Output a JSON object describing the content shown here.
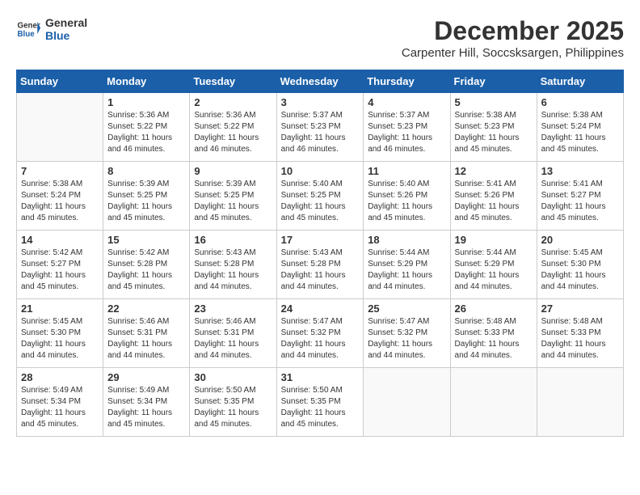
{
  "logo": {
    "line1": "General",
    "line2": "Blue"
  },
  "title": {
    "month": "December 2025",
    "location": "Carpenter Hill, Soccsksargen, Philippines"
  },
  "weekdays": [
    "Sunday",
    "Monday",
    "Tuesday",
    "Wednesday",
    "Thursday",
    "Friday",
    "Saturday"
  ],
  "weeks": [
    [
      {
        "day": "",
        "sunrise": "",
        "sunset": "",
        "daylight": ""
      },
      {
        "day": "1",
        "sunrise": "Sunrise: 5:36 AM",
        "sunset": "Sunset: 5:22 PM",
        "daylight": "Daylight: 11 hours and 46 minutes."
      },
      {
        "day": "2",
        "sunrise": "Sunrise: 5:36 AM",
        "sunset": "Sunset: 5:22 PM",
        "daylight": "Daylight: 11 hours and 46 minutes."
      },
      {
        "day": "3",
        "sunrise": "Sunrise: 5:37 AM",
        "sunset": "Sunset: 5:23 PM",
        "daylight": "Daylight: 11 hours and 46 minutes."
      },
      {
        "day": "4",
        "sunrise": "Sunrise: 5:37 AM",
        "sunset": "Sunset: 5:23 PM",
        "daylight": "Daylight: 11 hours and 46 minutes."
      },
      {
        "day": "5",
        "sunrise": "Sunrise: 5:38 AM",
        "sunset": "Sunset: 5:23 PM",
        "daylight": "Daylight: 11 hours and 45 minutes."
      },
      {
        "day": "6",
        "sunrise": "Sunrise: 5:38 AM",
        "sunset": "Sunset: 5:24 PM",
        "daylight": "Daylight: 11 hours and 45 minutes."
      }
    ],
    [
      {
        "day": "7",
        "sunrise": "Sunrise: 5:38 AM",
        "sunset": "Sunset: 5:24 PM",
        "daylight": "Daylight: 11 hours and 45 minutes."
      },
      {
        "day": "8",
        "sunrise": "Sunrise: 5:39 AM",
        "sunset": "Sunset: 5:25 PM",
        "daylight": "Daylight: 11 hours and 45 minutes."
      },
      {
        "day": "9",
        "sunrise": "Sunrise: 5:39 AM",
        "sunset": "Sunset: 5:25 PM",
        "daylight": "Daylight: 11 hours and 45 minutes."
      },
      {
        "day": "10",
        "sunrise": "Sunrise: 5:40 AM",
        "sunset": "Sunset: 5:25 PM",
        "daylight": "Daylight: 11 hours and 45 minutes."
      },
      {
        "day": "11",
        "sunrise": "Sunrise: 5:40 AM",
        "sunset": "Sunset: 5:26 PM",
        "daylight": "Daylight: 11 hours and 45 minutes."
      },
      {
        "day": "12",
        "sunrise": "Sunrise: 5:41 AM",
        "sunset": "Sunset: 5:26 PM",
        "daylight": "Daylight: 11 hours and 45 minutes."
      },
      {
        "day": "13",
        "sunrise": "Sunrise: 5:41 AM",
        "sunset": "Sunset: 5:27 PM",
        "daylight": "Daylight: 11 hours and 45 minutes."
      }
    ],
    [
      {
        "day": "14",
        "sunrise": "Sunrise: 5:42 AM",
        "sunset": "Sunset: 5:27 PM",
        "daylight": "Daylight: 11 hours and 45 minutes."
      },
      {
        "day": "15",
        "sunrise": "Sunrise: 5:42 AM",
        "sunset": "Sunset: 5:28 PM",
        "daylight": "Daylight: 11 hours and 45 minutes."
      },
      {
        "day": "16",
        "sunrise": "Sunrise: 5:43 AM",
        "sunset": "Sunset: 5:28 PM",
        "daylight": "Daylight: 11 hours and 44 minutes."
      },
      {
        "day": "17",
        "sunrise": "Sunrise: 5:43 AM",
        "sunset": "Sunset: 5:28 PM",
        "daylight": "Daylight: 11 hours and 44 minutes."
      },
      {
        "day": "18",
        "sunrise": "Sunrise: 5:44 AM",
        "sunset": "Sunset: 5:29 PM",
        "daylight": "Daylight: 11 hours and 44 minutes."
      },
      {
        "day": "19",
        "sunrise": "Sunrise: 5:44 AM",
        "sunset": "Sunset: 5:29 PM",
        "daylight": "Daylight: 11 hours and 44 minutes."
      },
      {
        "day": "20",
        "sunrise": "Sunrise: 5:45 AM",
        "sunset": "Sunset: 5:30 PM",
        "daylight": "Daylight: 11 hours and 44 minutes."
      }
    ],
    [
      {
        "day": "21",
        "sunrise": "Sunrise: 5:45 AM",
        "sunset": "Sunset: 5:30 PM",
        "daylight": "Daylight: 11 hours and 44 minutes."
      },
      {
        "day": "22",
        "sunrise": "Sunrise: 5:46 AM",
        "sunset": "Sunset: 5:31 PM",
        "daylight": "Daylight: 11 hours and 44 minutes."
      },
      {
        "day": "23",
        "sunrise": "Sunrise: 5:46 AM",
        "sunset": "Sunset: 5:31 PM",
        "daylight": "Daylight: 11 hours and 44 minutes."
      },
      {
        "day": "24",
        "sunrise": "Sunrise: 5:47 AM",
        "sunset": "Sunset: 5:32 PM",
        "daylight": "Daylight: 11 hours and 44 minutes."
      },
      {
        "day": "25",
        "sunrise": "Sunrise: 5:47 AM",
        "sunset": "Sunset: 5:32 PM",
        "daylight": "Daylight: 11 hours and 44 minutes."
      },
      {
        "day": "26",
        "sunrise": "Sunrise: 5:48 AM",
        "sunset": "Sunset: 5:33 PM",
        "daylight": "Daylight: 11 hours and 44 minutes."
      },
      {
        "day": "27",
        "sunrise": "Sunrise: 5:48 AM",
        "sunset": "Sunset: 5:33 PM",
        "daylight": "Daylight: 11 hours and 44 minutes."
      }
    ],
    [
      {
        "day": "28",
        "sunrise": "Sunrise: 5:49 AM",
        "sunset": "Sunset: 5:34 PM",
        "daylight": "Daylight: 11 hours and 45 minutes."
      },
      {
        "day": "29",
        "sunrise": "Sunrise: 5:49 AM",
        "sunset": "Sunset: 5:34 PM",
        "daylight": "Daylight: 11 hours and 45 minutes."
      },
      {
        "day": "30",
        "sunrise": "Sunrise: 5:50 AM",
        "sunset": "Sunset: 5:35 PM",
        "daylight": "Daylight: 11 hours and 45 minutes."
      },
      {
        "day": "31",
        "sunrise": "Sunrise: 5:50 AM",
        "sunset": "Sunset: 5:35 PM",
        "daylight": "Daylight: 11 hours and 45 minutes."
      },
      {
        "day": "",
        "sunrise": "",
        "sunset": "",
        "daylight": ""
      },
      {
        "day": "",
        "sunrise": "",
        "sunset": "",
        "daylight": ""
      },
      {
        "day": "",
        "sunrise": "",
        "sunset": "",
        "daylight": ""
      }
    ]
  ]
}
